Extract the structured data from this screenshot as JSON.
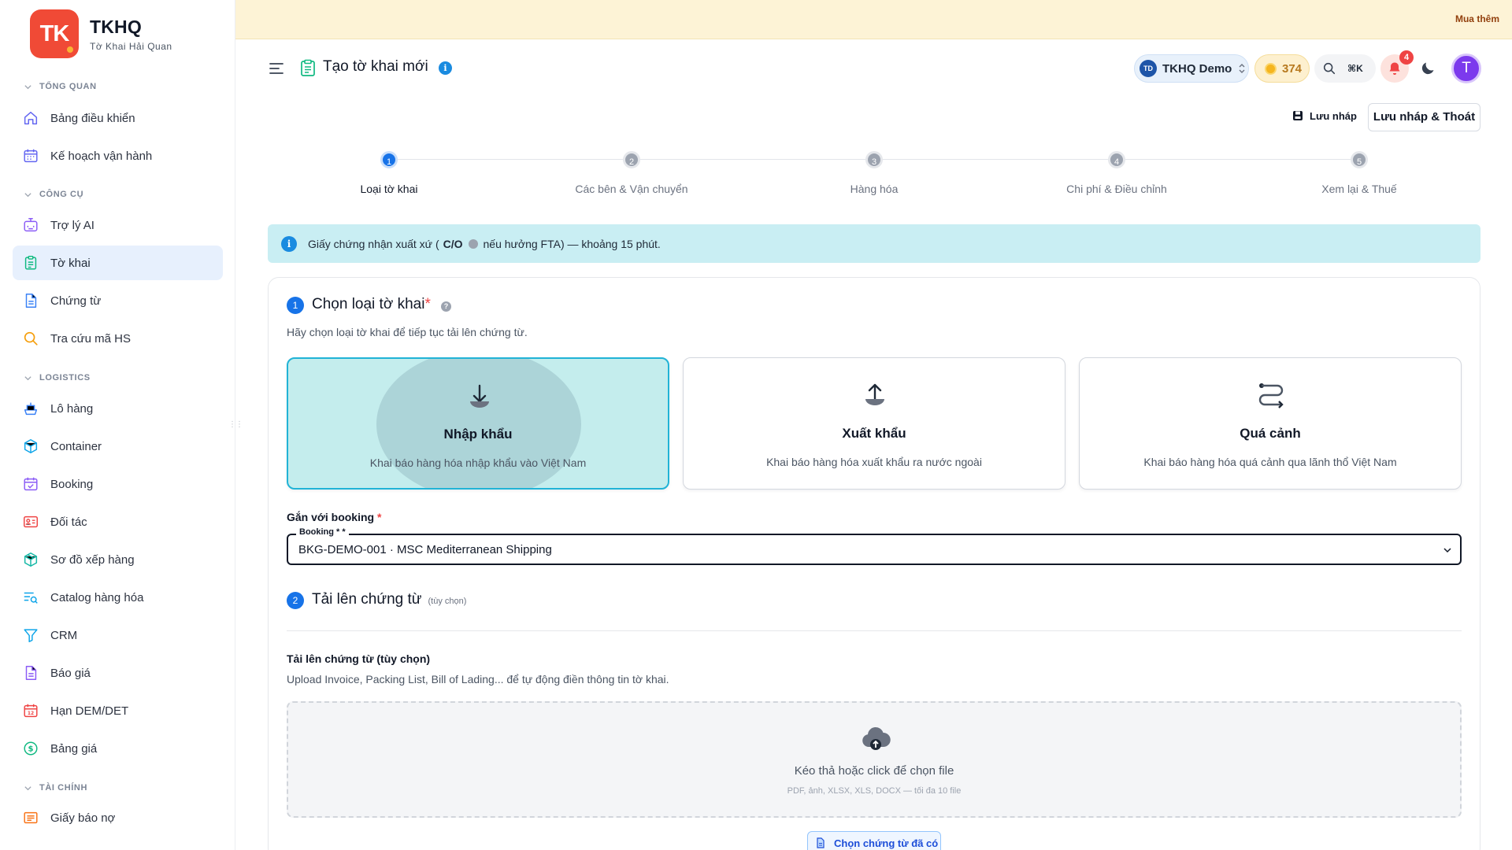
{
  "brand": {
    "logo_text": "TK",
    "name": "TKHQ",
    "subtitle": "Tờ Khai Hải Quan"
  },
  "banner": {
    "link": "Mua thêm"
  },
  "sidebar": {
    "sections": [
      {
        "label": "TỔNG QUAN"
      },
      {
        "label": "CÔNG CỤ"
      },
      {
        "label": "LOGISTICS"
      },
      {
        "label": "TÀI CHÍNH"
      }
    ],
    "items": [
      {
        "label": "Bảng điều khiển",
        "icon": "home-icon"
      },
      {
        "label": "Kế hoạch vận hành",
        "icon": "calendar-icon"
      },
      {
        "label": "Trợ lý AI",
        "icon": "bot-icon"
      },
      {
        "label": "Tờ khai",
        "icon": "clipboard-icon",
        "active": true
      },
      {
        "label": "Chứng từ",
        "icon": "file-icon"
      },
      {
        "label": "Tra cứu mã HS",
        "icon": "search-icon"
      },
      {
        "label": "Lô hàng",
        "icon": "ship-icon"
      },
      {
        "label": "Container",
        "icon": "box-icon"
      },
      {
        "label": "Booking",
        "icon": "calendar-check-icon"
      },
      {
        "label": "Đối tác",
        "icon": "contact-card-icon"
      },
      {
        "label": "Sơ đồ xếp hàng",
        "icon": "package-icon"
      },
      {
        "label": "Catalog hàng hóa",
        "icon": "list-search-icon"
      },
      {
        "label": "CRM",
        "icon": "funnel-icon"
      },
      {
        "label": "Báo giá",
        "icon": "document-icon"
      },
      {
        "label": "Hạn DEM/DET",
        "icon": "calendar-12-icon"
      },
      {
        "label": "Bảng giá",
        "icon": "dollar-circle-icon"
      },
      {
        "label": "Giấy báo nợ",
        "icon": "receipt-icon"
      }
    ]
  },
  "header": {
    "title": "Tạo tờ khai mới",
    "info_glyph": "i",
    "org_badge": "TD",
    "org_name": "TKHQ Demo",
    "credits": "374",
    "shortcut": "⌘K",
    "notifications": "4",
    "avatar_initial": "T"
  },
  "actions": {
    "save_draft": "Lưu nháp",
    "save_exit": "Lưu nháp & Thoát"
  },
  "stepper": {
    "steps": [
      {
        "num": "1",
        "label": "Loại tờ khai"
      },
      {
        "num": "2",
        "label": "Các bên & Vận chuyển"
      },
      {
        "num": "3",
        "label": "Hàng hóa"
      },
      {
        "num": "4",
        "label": "Chi phí & Điều chỉnh"
      },
      {
        "num": "5",
        "label": "Xem lại & Thuế"
      }
    ],
    "current": 1
  },
  "alert": {
    "prefix": "Giấy chứng nhận xuất xứ (",
    "bold": "C/O",
    "suffix": "nếu hưởng FTA) — khoảng 15 phút."
  },
  "section1": {
    "num": "1",
    "title": "Chọn loại tờ khai",
    "required_mark": "*",
    "desc": "Hãy chọn loại tờ khai để tiếp tục tải lên chứng từ.",
    "options": [
      {
        "title": "Nhập khẩu",
        "desc": "Khai báo hàng hóa nhập khẩu vào Việt Nam",
        "icon": "download-icon",
        "selected": true
      },
      {
        "title": "Xuất khẩu",
        "desc": "Khai báo hàng hóa xuất khẩu ra nước ngoài",
        "icon": "upload-icon",
        "selected": false
      },
      {
        "title": "Quá cảnh",
        "desc": "Khai báo hàng hóa quá cảnh qua lãnh thổ Việt Nam",
        "icon": "route-icon",
        "selected": false
      }
    ]
  },
  "booking": {
    "label": "Gắn với booking",
    "required_mark": "*",
    "legend": "Booking * *",
    "value": "BKG-DEMO-001 · MSC Mediterranean Shipping"
  },
  "section2": {
    "num": "2",
    "title": "Tải lên chứng từ",
    "hint": "(tùy chọn)",
    "upload_label": "Tải lên chứng từ (tùy chọn)",
    "upload_desc": "Upload Invoice, Packing List, Bill of Lading... để tự động điền thông tin tờ khai.",
    "drop_text": "Kéo thả hoặc click để chọn file",
    "drop_sub": "PDF, ảnh, XLSX, XLS, DOCX — tối đa 10 file",
    "pick_button": "Chọn chứng từ đã có"
  },
  "colors": {
    "accent": "#1773e8",
    "selected_bg": "#c4eded",
    "selected_border": "#21b3d6",
    "brand": "#f04a36"
  }
}
